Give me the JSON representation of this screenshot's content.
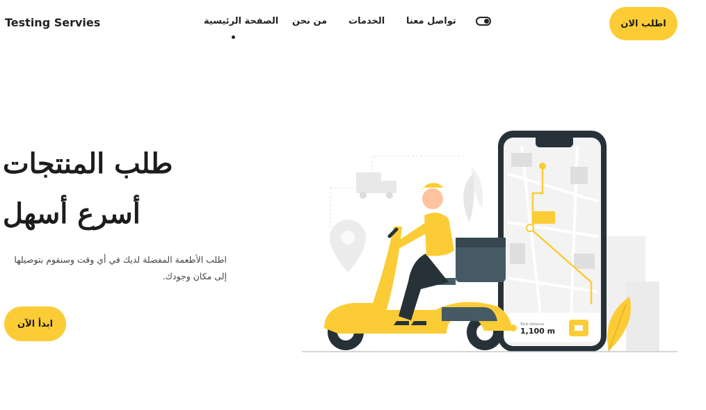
{
  "brand": "Testing Servies",
  "nav": {
    "home": "الصفحة الرئيسية",
    "about": "من نحن",
    "services": "الخدمات",
    "contact": "تواصل معنا",
    "cta": "اطلب الان"
  },
  "hero": {
    "title_line1": "طلب المنتجات",
    "title_line2": "أسرع أسهل",
    "description": "اطلب الأطعمة المفضلة لديك في أي وقت وسنقوم بتوصيلها إلى مكان وجودك.",
    "cta": "ابدأ الآن"
  },
  "illustration": {
    "distance_label": "Total distance",
    "distance_value": "1,100 m"
  },
  "colors": {
    "accent": "#fccc36",
    "text": "#1c1c1c",
    "phone": "#263238"
  }
}
